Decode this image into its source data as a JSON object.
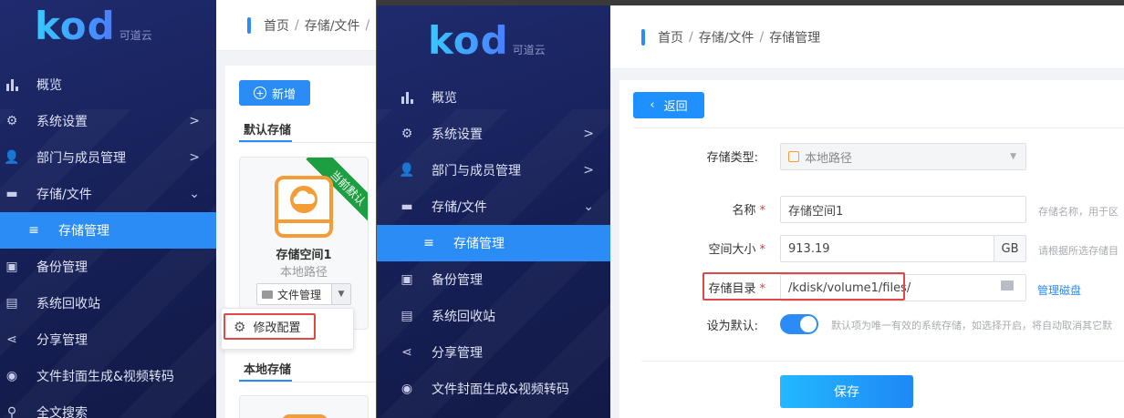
{
  "brand": {
    "logo_text": "kod",
    "logo_sub": "可道云"
  },
  "left": {
    "nav": [
      {
        "label": "概览",
        "icon": "bar-chart-icon"
      },
      {
        "label": "系统设置",
        "icon": "gear-icon",
        "arrow": ">"
      },
      {
        "label": "部门与成员管理",
        "icon": "users-icon",
        "arrow": ">"
      },
      {
        "label": "存储/文件",
        "icon": "folder-icon",
        "arrow": "⌄"
      },
      {
        "label": "存储管理",
        "icon": "database-icon",
        "active": true
      },
      {
        "label": "备份管理",
        "icon": "backup-icon"
      },
      {
        "label": "系统回收站",
        "icon": "recycle-icon"
      },
      {
        "label": "分享管理",
        "icon": "share-icon"
      },
      {
        "label": "文件封面生成&视频转码",
        "icon": "video-icon"
      },
      {
        "label": "全文搜索",
        "icon": "search-icon"
      }
    ],
    "breadcrumb": [
      "首页",
      "存储/文件"
    ],
    "add_button": "新增",
    "section_default": "默认存储",
    "section_local": "本地存储",
    "card": {
      "ribbon": "当前默认",
      "name": "存储空间1",
      "type": "本地路径",
      "file_manage_button": "文件管理",
      "dropdown_item": "修改配置"
    }
  },
  "right": {
    "nav": [
      {
        "label": "概览",
        "icon": "bar-chart-icon"
      },
      {
        "label": "系统设置",
        "icon": "gear-icon",
        "arrow": ">"
      },
      {
        "label": "部门与成员管理",
        "icon": "users-icon",
        "arrow": ">"
      },
      {
        "label": "存储/文件",
        "icon": "folder-icon",
        "arrow": "⌄"
      },
      {
        "label": "存储管理",
        "icon": "database-icon",
        "active": true
      },
      {
        "label": "备份管理",
        "icon": "backup-icon"
      },
      {
        "label": "系统回收站",
        "icon": "recycle-icon"
      },
      {
        "label": "分享管理",
        "icon": "share-icon"
      },
      {
        "label": "文件封面生成&视频转码",
        "icon": "video-icon"
      }
    ],
    "breadcrumb": [
      "首页",
      "存储/文件",
      "存储管理"
    ],
    "back_button": "返回",
    "form": {
      "type_label": "存储类型:",
      "type_value": "本地路径",
      "name_label": "名称",
      "name_value": "存储空间1",
      "name_hint": "存储名称，用于区",
      "size_label": "空间大小",
      "size_value": "913.19",
      "size_unit": "GB",
      "size_hint": "请根据所选存储目",
      "dir_label": "存储目录",
      "dir_value": "/kdisk/volume1/files/",
      "dir_link": "管理磁盘",
      "default_label": "设为默认:",
      "default_on": true,
      "default_hint": "默认项为唯一有效的系统存储，如选择开启，将自动取消其它默",
      "save_button": "保存"
    }
  },
  "colors": {
    "primary": "#2b8cf6",
    "sidebar": "#1a2360",
    "ribbon": "#1d9e41",
    "highlight": "#e04848",
    "drive": "#f29d38"
  }
}
